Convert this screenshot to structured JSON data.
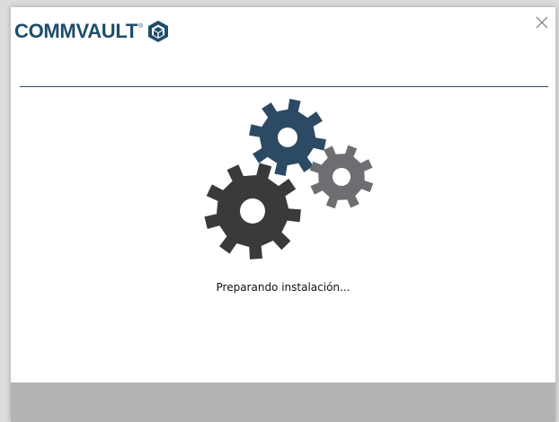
{
  "app": {
    "brand": "COMMVAULT",
    "trademark": "®"
  },
  "icons": {
    "brand_mark": "commvault-logo-icon",
    "close": "close-icon",
    "progress": "gears-icon"
  },
  "status": {
    "text": "Preparando instalación..."
  },
  "colors": {
    "brand": "#1e4d6b",
    "gear_large": "#3a3a3a",
    "gear_top": "#2c4a63",
    "gear_small": "#6e6e72",
    "divider": "#2f4d6b",
    "footer": "#b4b4b4"
  }
}
